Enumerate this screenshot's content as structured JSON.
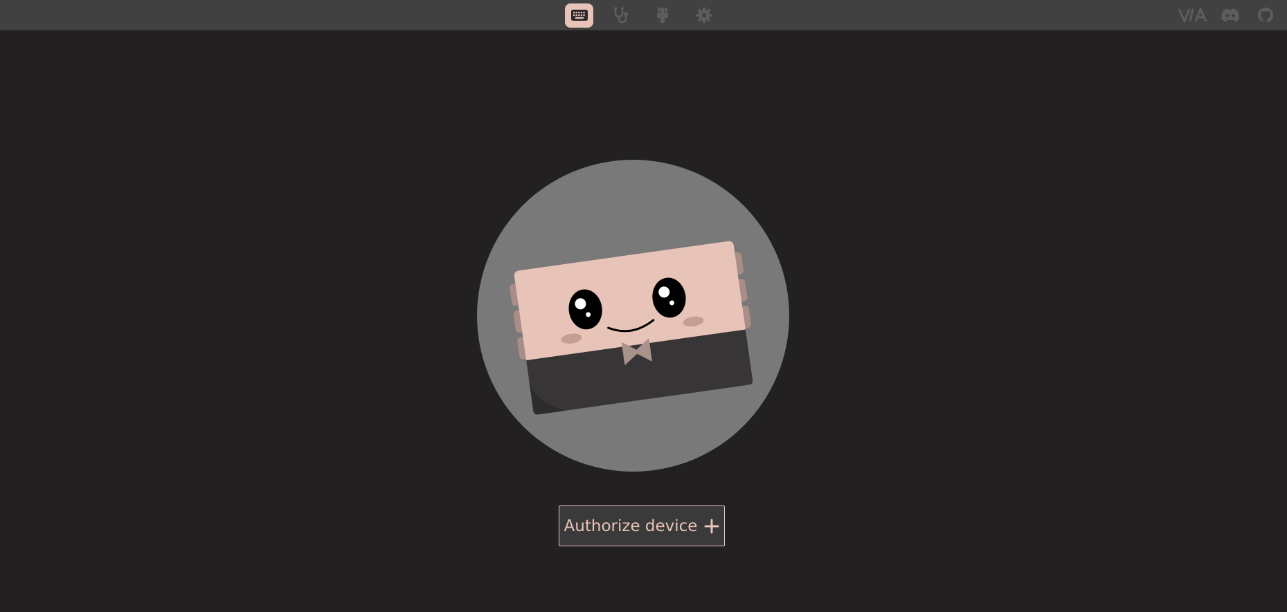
{
  "colors": {
    "accent": "#e8c4b8",
    "background": "#222021",
    "topbar": "#424141",
    "icon_muted": "#5e5c5c",
    "mascot_circle": "#797979",
    "button_bg": "#3b3a3a"
  },
  "nav": {
    "tabs": [
      {
        "icon": "keyboard-icon",
        "active": true
      },
      {
        "icon": "stethoscope-icon",
        "active": false
      },
      {
        "icon": "brush-icon",
        "active": false
      },
      {
        "icon": "gear-icon",
        "active": false
      }
    ]
  },
  "links": {
    "via_logo": "VIA",
    "discord_icon": "discord-icon",
    "github_icon": "github-icon"
  },
  "mascot": {
    "icon": "keyboard-mascot-illustration"
  },
  "main": {
    "authorize_label": "Authorize device",
    "authorize_icon": "plus-icon"
  }
}
